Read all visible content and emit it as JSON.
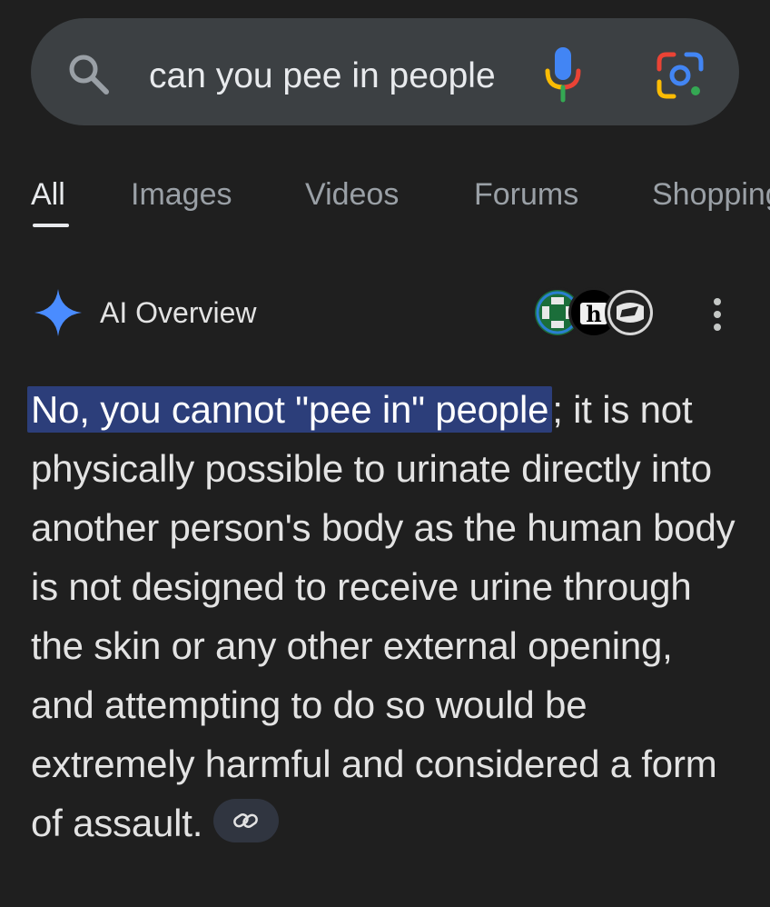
{
  "search": {
    "query": "can you pee in people",
    "icons": [
      "search-icon",
      "microphone-icon",
      "google-lens-icon"
    ]
  },
  "tabs": [
    {
      "label": "All",
      "active": true
    },
    {
      "label": "Images",
      "active": false
    },
    {
      "label": "Videos",
      "active": false
    },
    {
      "label": "Forums",
      "active": false
    },
    {
      "label": "Shopping",
      "active": false
    }
  ],
  "ai_overview": {
    "title": "AI Overview",
    "icon": "sparkle-icon",
    "sources": [
      "source-avatar-1",
      "source-avatar-2",
      "source-avatar-3"
    ],
    "more_icon": "more-vertical-icon",
    "highlighted_text": "No, you cannot \"pee in\" people",
    "body_text": "; it is not physically possible to urinate directly into another person's body as the human body is not designed to receive urine through the skin or any other external opening, and attempting to do so would be extremely harmful and considered a form of assault.",
    "link_icon": "link-icon"
  },
  "colors": {
    "background": "#1f1f1f",
    "search_bar": "#3c4043",
    "highlight": "#2c3e7a",
    "sparkle": "#4a8cff"
  }
}
